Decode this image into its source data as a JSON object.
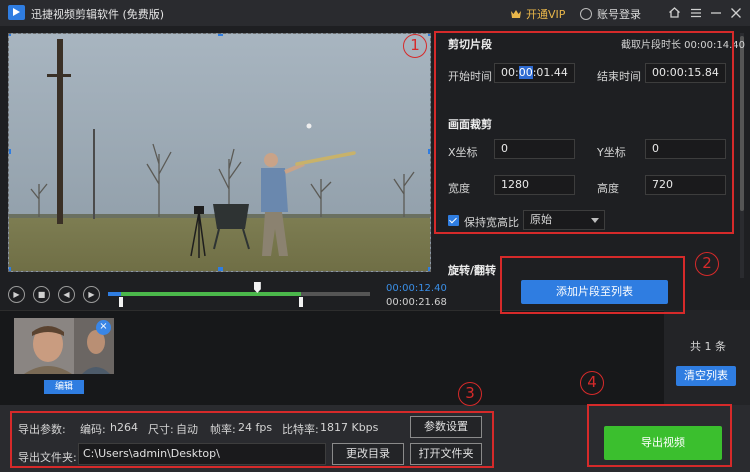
{
  "titlebar": {
    "title": "迅捷视频剪辑软件 (免费版)",
    "vip_label": "开通VIP",
    "login_label": "账号登录",
    "icons": [
      "home-icon",
      "menu-icon",
      "minimize-icon",
      "close-icon"
    ]
  },
  "preview": {
    "current_time": "00:00:12.40",
    "total_time": "00:00:21.68",
    "playhead_fraction": 0.57
  },
  "controls": {
    "icons": [
      "play-icon",
      "stop-icon",
      "prev-frame-icon",
      "next-frame-icon"
    ]
  },
  "cut": {
    "section_title": "剪切片段",
    "duration_label": "截取片段时长 00:00:14.40",
    "start_label": "开始时间",
    "start_prefix": "00:",
    "start_highlight": "00",
    "start_suffix": ":01.44",
    "end_label": "结束时间",
    "end_value": "00:00:15.84"
  },
  "crop": {
    "section_title": "画面裁剪",
    "x_label": "X坐标",
    "x_value": "0",
    "y_label": "Y坐标",
    "y_value": "0",
    "width_label": "宽度",
    "width_value": "1280",
    "height_label": "高度",
    "height_value": "720",
    "keep_ratio_label": "保持宽高比",
    "keep_ratio_checked": true,
    "ratio_option": "原始"
  },
  "rotate": {
    "section_title": "旋转/翻转"
  },
  "add_clip_button": "添加片段至列表",
  "clip_list": {
    "count_label": "共 1 条",
    "clear_button": "清空列表",
    "edit_button": "编辑"
  },
  "export": {
    "params_label": "导出参数:",
    "codec_label": "编码:",
    "codec_value": "h264",
    "size_label": "尺寸:",
    "size_value": "自动",
    "fps_label": "帧率:",
    "fps_value": "24 fps",
    "bitrate_label": "比特率:",
    "bitrate_value": "1817 Kbps",
    "settings_button": "参数设置",
    "folder_label": "导出文件夹:",
    "folder_path": "C:\\Users\\admin\\Desktop\\",
    "change_dir_button": "更改目录",
    "open_folder_button": "打开文件夹",
    "export_button": "导出视频"
  },
  "annotations": [
    "1",
    "2",
    "3",
    "4"
  ],
  "colors": {
    "accent_blue": "#2f7de1",
    "export_green": "#3bbf2e",
    "annotation_red": "#d62a2a",
    "vip_gold": "#e8b64a"
  }
}
